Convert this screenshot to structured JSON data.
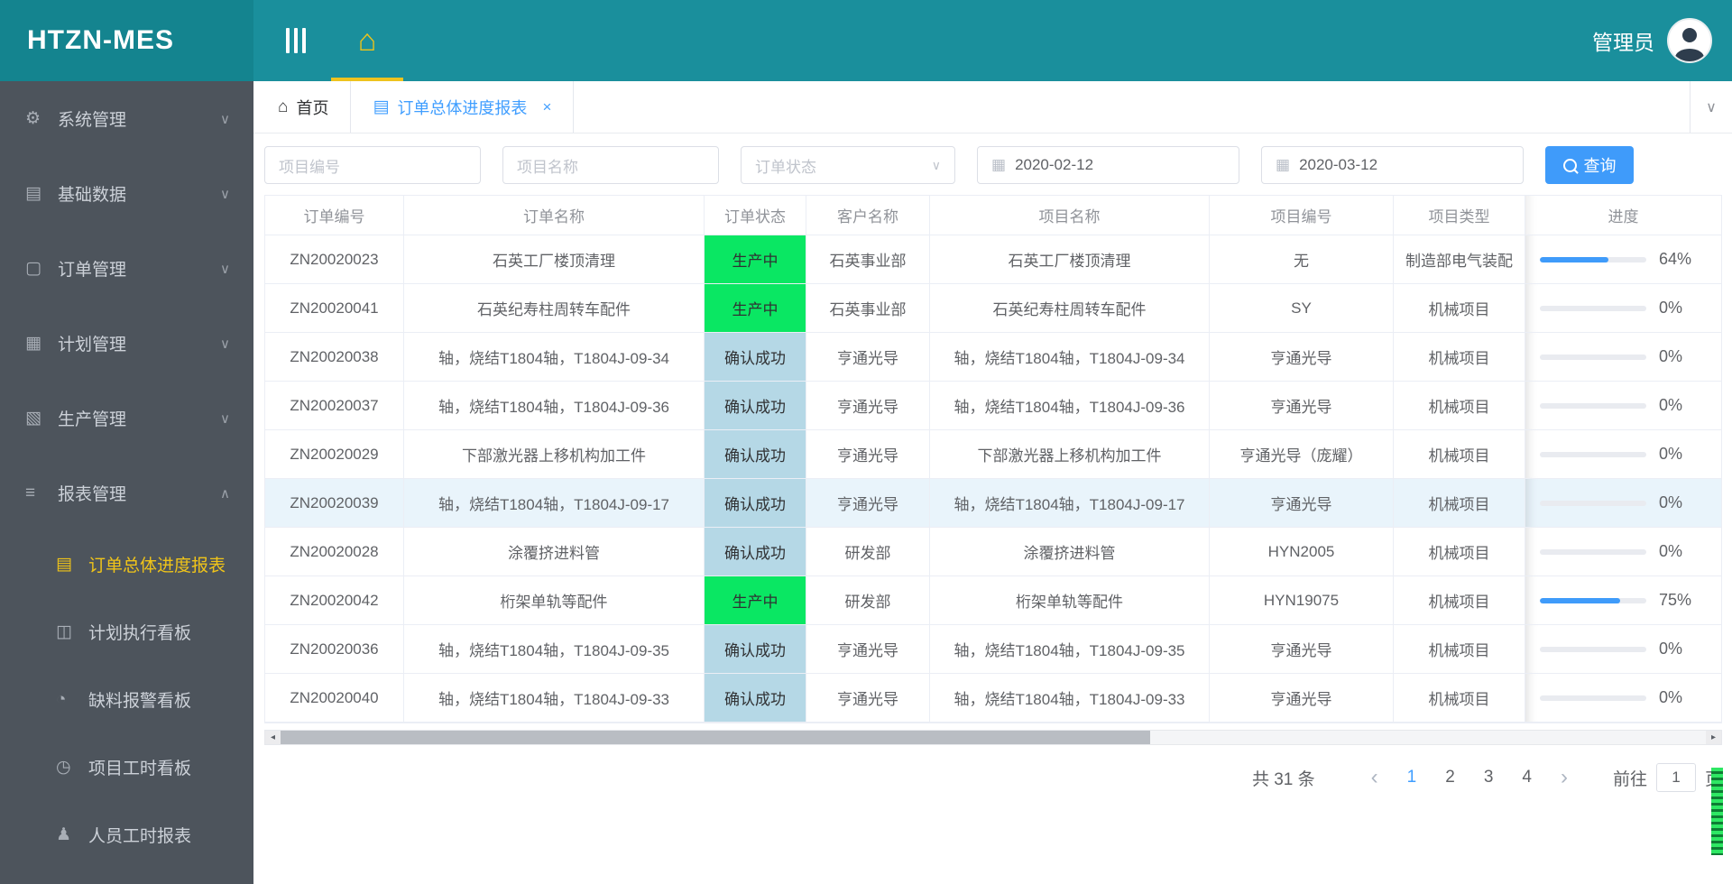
{
  "app": {
    "logo": "HTZN-MES",
    "user": "管理员"
  },
  "icons": {
    "gear": "⚙",
    "database": "▤",
    "order_doc": "▢",
    "plan_grid": "▦",
    "production": "▧",
    "report_list": "≡",
    "report_active": "▤",
    "board": "◫",
    "alert": "◔",
    "clock": "◷",
    "person": "♟",
    "chevron_down": "∨",
    "chevron_up": "∧",
    "home": "⌂",
    "tab_list": "▤",
    "close": "×",
    "calendar": "▦",
    "select_arrow": "∨",
    "tabbar_arrow": "∨",
    "prev": "‹",
    "next": "›",
    "scroll_left": "◂",
    "scroll_right": "▸"
  },
  "colors": {
    "header_teal": "#1a8f9c",
    "sidebar_dark": "#4d545c",
    "gold_accent": "#f0c419",
    "status_producing": "#0ae763",
    "status_confirmed": "#b5d8e6",
    "accent_blue": "#409eff",
    "row_highlight": "#e9f4fb"
  },
  "sidebar": {
    "items": [
      {
        "label": "系统管理"
      },
      {
        "label": "基础数据"
      },
      {
        "label": "订单管理"
      },
      {
        "label": "计划管理"
      },
      {
        "label": "生产管理"
      },
      {
        "label": "报表管理"
      }
    ],
    "subitems": [
      {
        "label": "订单总体进度报表",
        "active": true
      },
      {
        "label": "计划执行看板"
      },
      {
        "label": "缺料报警看板"
      },
      {
        "label": "项目工时看板"
      },
      {
        "label": "人员工时报表"
      }
    ]
  },
  "tabs": [
    {
      "label": "首页"
    },
    {
      "label": "订单总体进度报表",
      "closable": true,
      "active": true
    }
  ],
  "filters": {
    "project_no_placeholder": "项目编号",
    "project_name_placeholder": "项目名称",
    "order_status_placeholder": "订单状态",
    "date_from": "2020-02-12",
    "date_to": "2020-03-12",
    "search_label": "查询"
  },
  "table": {
    "columns": [
      "订单编号",
      "订单名称",
      "订单状态",
      "客户名称",
      "项目名称",
      "项目编号",
      "项目类型",
      "进度"
    ],
    "rows": [
      {
        "order_no": "ZN20020023",
        "order_name": "石英工厂楼顶清理",
        "status": "生产中",
        "status_type": "producing",
        "customer": "石英事业部",
        "project_name": "石英工厂楼顶清理",
        "project_no": "无",
        "project_type": "制造部电气装配",
        "progress": 64
      },
      {
        "order_no": "ZN20020041",
        "order_name": "石英纪寿柱周转车配件",
        "status": "生产中",
        "status_type": "producing",
        "customer": "石英事业部",
        "project_name": "石英纪寿柱周转车配件",
        "project_no": "SY",
        "project_type": "机械项目",
        "progress": 0
      },
      {
        "order_no": "ZN20020038",
        "order_name": "轴，烧结T1804轴，T1804J-09-34",
        "status": "确认成功",
        "status_type": "confirmed",
        "customer": "亨通光导",
        "project_name": "轴，烧结T1804轴，T1804J-09-34",
        "project_no": "亨通光导",
        "project_type": "机械项目",
        "progress": 0
      },
      {
        "order_no": "ZN20020037",
        "order_name": "轴，烧结T1804轴，T1804J-09-36",
        "status": "确认成功",
        "status_type": "confirmed",
        "customer": "亨通光导",
        "project_name": "轴，烧结T1804轴，T1804J-09-36",
        "project_no": "亨通光导",
        "project_type": "机械项目",
        "progress": 0
      },
      {
        "order_no": "ZN20020029",
        "order_name": "下部激光器上移机构加工件",
        "status": "确认成功",
        "status_type": "confirmed",
        "customer": "亨通光导",
        "project_name": "下部激光器上移机构加工件",
        "project_no": "亨通光导（庞耀）",
        "project_type": "机械项目",
        "progress": 0
      },
      {
        "order_no": "ZN20020039",
        "order_name": "轴，烧结T1804轴，T1804J-09-17",
        "status": "确认成功",
        "status_type": "confirmed",
        "customer": "亨通光导",
        "project_name": "轴，烧结T1804轴，T1804J-09-17",
        "project_no": "亨通光导",
        "project_type": "机械项目",
        "progress": 0,
        "highlighted": true
      },
      {
        "order_no": "ZN20020028",
        "order_name": "涂覆挤进料管",
        "status": "确认成功",
        "status_type": "confirmed",
        "customer": "研发部",
        "project_name": "涂覆挤进料管",
        "project_no": "HYN2005",
        "project_type": "机械项目",
        "progress": 0
      },
      {
        "order_no": "ZN20020042",
        "order_name": "桁架单轨等配件",
        "status": "生产中",
        "status_type": "producing",
        "customer": "研发部",
        "project_name": "桁架单轨等配件",
        "project_no": "HYN19075",
        "project_type": "机械项目",
        "progress": 75
      },
      {
        "order_no": "ZN20020036",
        "order_name": "轴，烧结T1804轴，T1804J-09-35",
        "status": "确认成功",
        "status_type": "confirmed",
        "customer": "亨通光导",
        "project_name": "轴，烧结T1804轴，T1804J-09-35",
        "project_no": "亨通光导",
        "project_type": "机械项目",
        "progress": 0
      },
      {
        "order_no": "ZN20020040",
        "order_name": "轴，烧结T1804轴，T1804J-09-33",
        "status": "确认成功",
        "status_type": "confirmed",
        "customer": "亨通光导",
        "project_name": "轴，烧结T1804轴，T1804J-09-33",
        "project_no": "亨通光导",
        "project_type": "机械项目",
        "progress": 0
      }
    ]
  },
  "pagination": {
    "total_label": "共 31 条",
    "pages": [
      "1",
      "2",
      "3",
      "4"
    ],
    "active_page": "1",
    "goto_label": "前往",
    "goto_value": "1",
    "page_unit_label": "页"
  }
}
